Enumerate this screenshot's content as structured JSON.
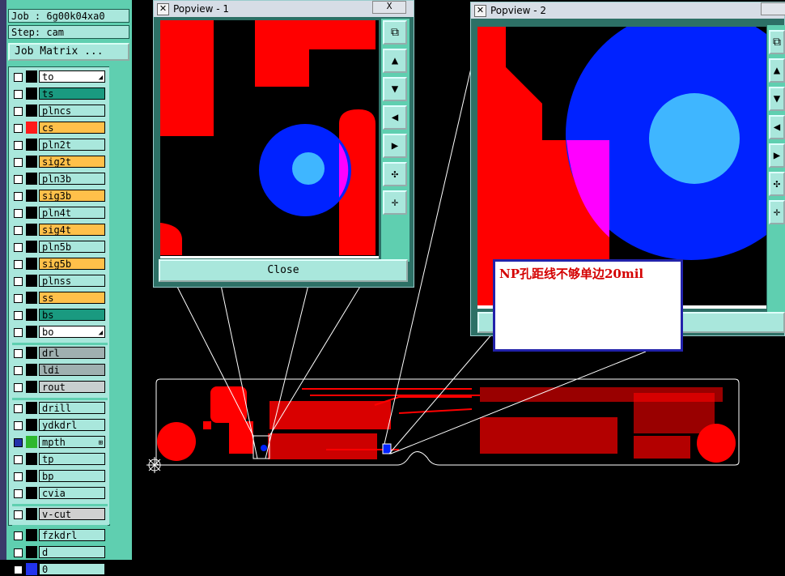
{
  "job": {
    "label": "Job : 6g00k04xa0",
    "step": "Step: cam",
    "matrix_button": "Job Matrix ..."
  },
  "layers": [
    {
      "name": "to",
      "color": "#ffffff",
      "mark": "◢"
    },
    {
      "name": "ts",
      "color": "#1a9a80",
      "mark": ""
    },
    {
      "name": "plncs",
      "color": "#a9e7dc",
      "mark": ""
    },
    {
      "name": "cs",
      "color": "#ffc04a",
      "swatch": "#ff1a1a",
      "mark": ""
    },
    {
      "name": "pln2t",
      "color": "#a9e7dc",
      "mark": ""
    },
    {
      "name": "sig2t",
      "color": "#ffc04a",
      "mark": ""
    },
    {
      "name": "pln3b",
      "color": "#a9e7dc",
      "mark": ""
    },
    {
      "name": "sig3b",
      "color": "#ffc04a",
      "mark": ""
    },
    {
      "name": "pln4t",
      "color": "#a9e7dc",
      "mark": ""
    },
    {
      "name": "sig4t",
      "color": "#ffc04a",
      "mark": ""
    },
    {
      "name": "pln5b",
      "color": "#a9e7dc",
      "mark": ""
    },
    {
      "name": "sig5b",
      "color": "#ffc04a",
      "mark": ""
    },
    {
      "name": "plnss",
      "color": "#a9e7dc",
      "mark": ""
    },
    {
      "name": "ss",
      "color": "#ffc04a",
      "mark": ""
    },
    {
      "name": "bs",
      "color": "#1a9a80",
      "mark": ""
    },
    {
      "name": "bo",
      "color": "#ffffff",
      "mark": "◢"
    },
    {
      "name": "drl",
      "color": "#9fb0b0",
      "mark": ""
    },
    {
      "name": "ldi",
      "color": "#9fb0b0",
      "mark": ""
    },
    {
      "name": "rout",
      "color": "#c8cfcf",
      "mark": ""
    },
    {
      "name": "drill",
      "color": "#a9e7dc",
      "mark": ""
    },
    {
      "name": "ydkdrl",
      "color": "#a9e7dc",
      "mark": ""
    },
    {
      "name": "mpth",
      "color": "#a9e7dc",
      "swatch": "#2eb82e",
      "checked": true,
      "mark": "⊞"
    },
    {
      "name": "tp",
      "color": "#a9e7dc",
      "mark": ""
    },
    {
      "name": "bp",
      "color": "#a9e7dc",
      "mark": ""
    },
    {
      "name": "cvia",
      "color": "#a9e7dc",
      "mark": ""
    },
    {
      "name": "v-cut",
      "color": "#d0d0d0",
      "mark": ""
    },
    {
      "name": "fzkdrl",
      "color": "#a9e7dc",
      "mark": ""
    },
    {
      "name": "d",
      "color": "#a9e7dc",
      "mark": ""
    },
    {
      "name": "0",
      "color": "#a9e7dc",
      "swatch": "#2233ee",
      "mark": ""
    }
  ],
  "popview1": {
    "title": "Popview - 1",
    "close_label": "Close",
    "close_x": "X"
  },
  "popview2": {
    "title": "Popview - 2"
  },
  "note": {
    "text": "NP孔距线不够单边20mil"
  },
  "colors": {
    "copper": "#ff0000",
    "pad": "#0022ff",
    "hole": "#3fb6ff",
    "overlap": "#ff00ff",
    "outline": "#ffffff"
  }
}
